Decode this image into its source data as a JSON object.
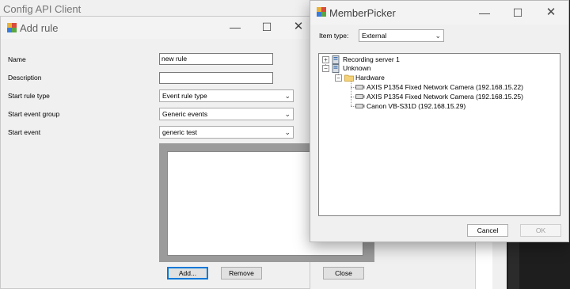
{
  "background": {
    "window_title": "Config API Client"
  },
  "add_rule": {
    "title": "Add rule",
    "fields": {
      "name": {
        "label": "Name",
        "value": "new rule"
      },
      "description": {
        "label": "Description",
        "value": ""
      },
      "start_rule_type": {
        "label": "Start rule type",
        "value": "Event rule type"
      },
      "start_event_group": {
        "label": "Start event group",
        "value": "Generic events"
      },
      "start_event": {
        "label": "Start event",
        "value": "generic test"
      }
    },
    "buttons": {
      "add": "Add...",
      "remove": "Remove",
      "close": "Close"
    }
  },
  "member_picker": {
    "title": "MemberPicker",
    "item_type": {
      "label": "Item type:",
      "value": "External"
    },
    "tree": {
      "recording_server": "Recording server 1",
      "unknown": "Unknown",
      "hardware": "Hardware",
      "cameras": [
        "AXIS P1354 Fixed Network Camera (192.168.15.22)",
        "AXIS P1354 Fixed Network Camera (192.168.15.25)",
        "Canon VB-S31D (192.168.15.29)"
      ]
    },
    "buttons": {
      "cancel": "Cancel",
      "ok": "OK"
    }
  },
  "colors": {
    "dialog_bg": "#f0f0f0",
    "focus_accent": "#0078d7",
    "group_frame": "#9b9b9b",
    "disabled_text": "#a0a0a0"
  },
  "icons": {
    "app": "app-icon",
    "minimize": "minimize-icon",
    "maximize": "maximize-icon",
    "close": "close-icon",
    "dropdown": "chevron-down-icon",
    "server": "server-icon",
    "folder": "folder-icon",
    "camera": "camera-icon"
  }
}
